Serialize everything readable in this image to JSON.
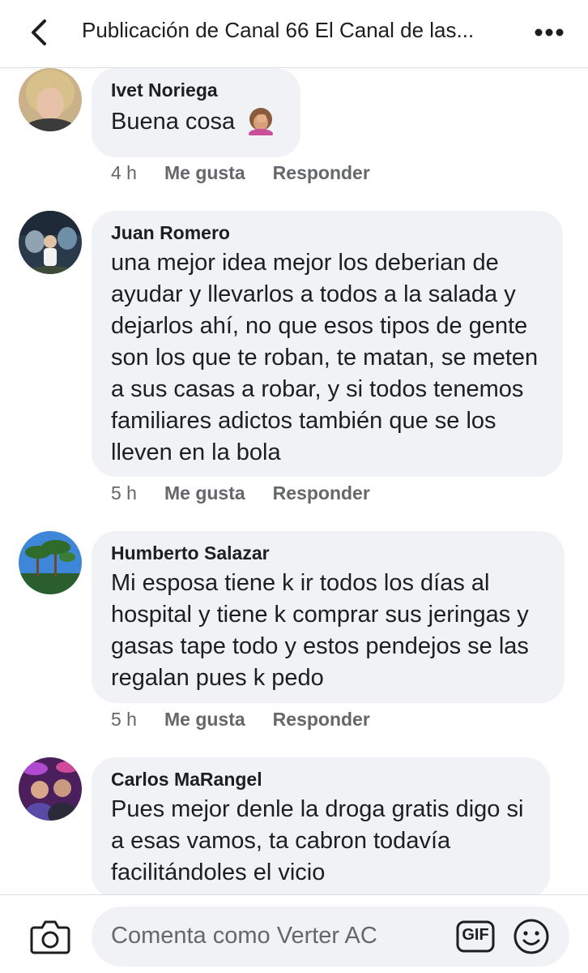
{
  "header": {
    "title": "Publicación de Canal 66 El Canal de las...",
    "back_icon": "chevron-left-icon",
    "more_icon": "more-dots-icon"
  },
  "comments": [
    {
      "author": "Ivet Noriega",
      "text": "Buena cosa",
      "emoji": "face-palm-emoji",
      "time": "4 h",
      "like_label": "Me gusta",
      "reply_label": "Responder"
    },
    {
      "author": "Juan Romero",
      "text": "una mejor idea mejor los deberian de ayudar y llevarlos a todos a la salada y dejarlos ahí, no que esos tipos de gente son los que te roban, te matan, se meten a sus casas a robar, y si todos tenemos familiares adictos también que se los lleven en la bola",
      "time": "5 h",
      "like_label": "Me gusta",
      "reply_label": "Responder"
    },
    {
      "author": "Humberto Salazar",
      "text": "Mi esposa tiene k ir todos los días al hospital y tiene k comprar sus jeringas y gasas tape todo y estos pendejos se las regalan pues k pedo",
      "time": "5 h",
      "like_label": "Me gusta",
      "reply_label": "Responder"
    },
    {
      "author": "Carlos MaRangel",
      "text": "Pues mejor denle la droga gratis digo si a esas vamos, ta cabron todavía facilitándoles el vicio"
    }
  ],
  "composer": {
    "placeholder": "Comenta como Verter AC",
    "camera_icon": "camera-icon",
    "gif_label": "GIF",
    "emoji_icon": "smiley-icon"
  },
  "colors": {
    "bubble": "#f0f2f5",
    "meta_text": "#65676b",
    "primary_text": "#1c1e21"
  }
}
